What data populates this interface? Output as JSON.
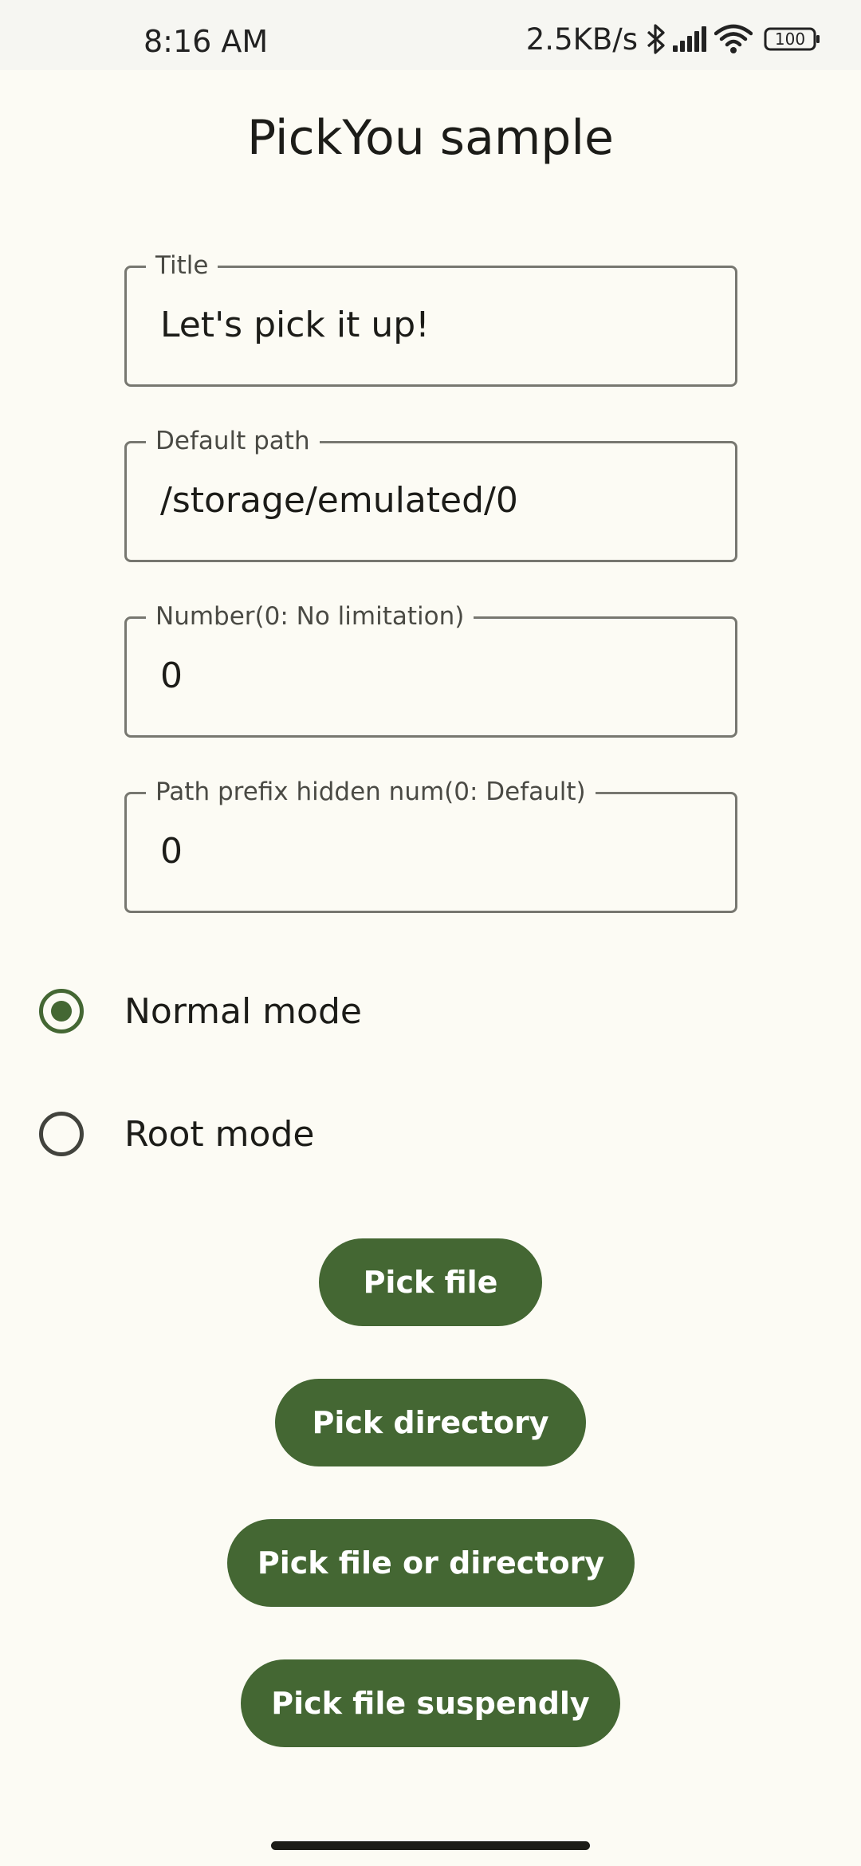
{
  "status_bar": {
    "time": "8:16 AM",
    "net_speed": "2.5KB/s",
    "battery": "100",
    "icons": [
      "bluetooth-icon",
      "signal-icon",
      "wifi-icon",
      "battery-icon"
    ]
  },
  "app": {
    "title": "PickYou sample"
  },
  "fields": {
    "title": {
      "label": "Title",
      "value": "Let's pick it up!"
    },
    "default_path": {
      "label": "Default path",
      "value": "/storage/emulated/0"
    },
    "number": {
      "label": "Number(0: No limitation)",
      "value": "0"
    },
    "prefix_hidden": {
      "label": "Path prefix hidden num(0: Default)",
      "value": "0"
    }
  },
  "modes": {
    "normal": {
      "label": "Normal mode",
      "selected": true
    },
    "root": {
      "label": "Root mode",
      "selected": false
    }
  },
  "buttons": {
    "pick_file": "Pick file",
    "pick_directory": "Pick directory",
    "pick_file_or_directory": "Pick file or directory",
    "pick_file_suspendly": "Pick file suspendly"
  },
  "colors": {
    "background": "#fcfbf4",
    "accent": "#446733",
    "outline": "#777770"
  }
}
